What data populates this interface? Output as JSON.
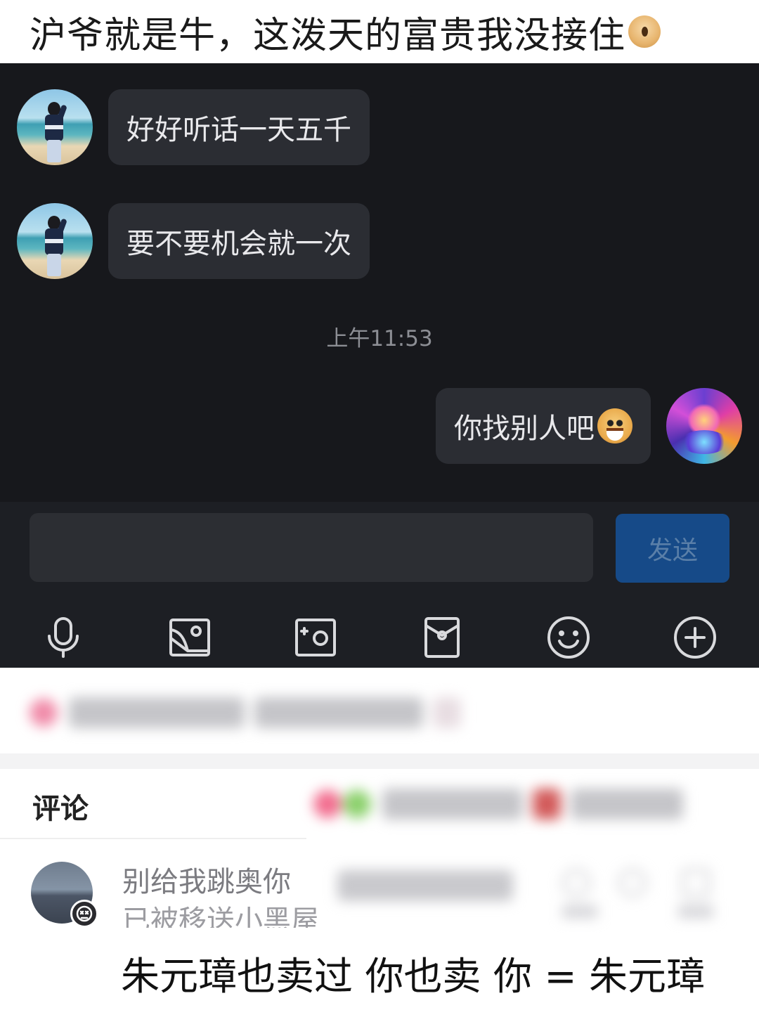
{
  "caption": {
    "text": "沪爷就是牛，这泼天的富贵我没接住",
    "emoji": "sad-face-emoji"
  },
  "chat": {
    "messages": [
      {
        "side": "left",
        "text": "好好听话一天五千",
        "avatar": "beach-person-avatar"
      },
      {
        "side": "left",
        "text": "要不要机会就一次",
        "avatar": "beach-person-avatar"
      },
      {
        "side": "right",
        "text": "你找别人吧",
        "emoji": "dog-emoji",
        "avatar": "anime-avatar"
      }
    ],
    "timestamp": "上午11:53",
    "input": {
      "value": "",
      "placeholder": ""
    },
    "send_label": "发送",
    "toolbar_icons": [
      "microphone-icon",
      "image-icon",
      "camera-icon",
      "red-envelope-icon",
      "emoji-icon",
      "plus-icon"
    ],
    "colors": {
      "background": "#17181c",
      "bubble": "#2b2d33",
      "send_button": "#164a88"
    }
  },
  "comments": {
    "title": "评论",
    "first": {
      "user": "别给我跳奥你",
      "status": "已被移送小黑屋"
    }
  },
  "bottom_caption": "朱元璋也卖过 你也卖 你 = 朱元璋"
}
